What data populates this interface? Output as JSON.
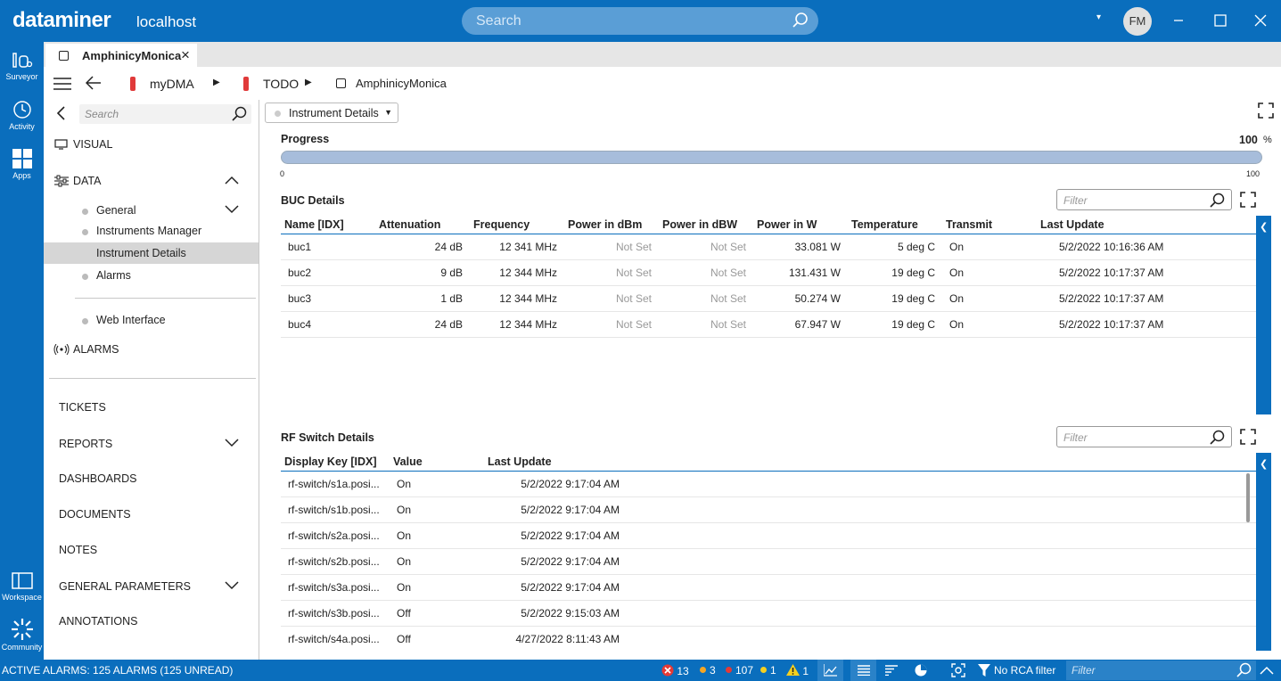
{
  "app": {
    "brand": "dataminer",
    "host": "localhost",
    "search_placeholder": "Search",
    "user_initials": "FM"
  },
  "rail": [
    {
      "label": "Surveyor",
      "icon": "surveyor-icon"
    },
    {
      "label": "Activity",
      "icon": "activity-icon"
    },
    {
      "label": "Apps",
      "icon": "apps-icon"
    },
    {
      "label": "Workspace",
      "icon": "workspace-icon"
    },
    {
      "label": "Community",
      "icon": "community-icon"
    }
  ],
  "tab": {
    "label": "AmphinicyMonica"
  },
  "breadcrumb": [
    "myDMA",
    "TODO",
    "AmphinicyMonica"
  ],
  "sidebar": {
    "search_placeholder": "Search",
    "visual": "VISUAL",
    "data": "DATA",
    "data_items": [
      "General",
      "Instruments Manager",
      "Instrument Details",
      "Alarms"
    ],
    "web_interface": "Web Interface",
    "alarms": "ALARMS",
    "sections": [
      "TICKETS",
      "REPORTS",
      "DASHBOARDS",
      "DOCUMENTS",
      "NOTES",
      "GENERAL PARAMETERS",
      "ANNOTATIONS"
    ]
  },
  "main": {
    "page_select": "Instrument Details",
    "progress": {
      "label": "Progress",
      "value_text": "100",
      "unit": "%",
      "min": "0",
      "max": "100",
      "fraction": 1.0
    },
    "buc": {
      "title": "BUC Details",
      "filter_placeholder": "Filter",
      "columns": [
        "Name [IDX]",
        "Attenuation",
        "Frequency",
        "Power in dBm",
        "Power in dBW",
        "Power in W",
        "Temperature",
        "Transmit",
        "Last Update"
      ],
      "rows": [
        [
          "buc1",
          "24 dB",
          "12 341 MHz",
          "Not Set",
          "Not Set",
          "33.081 W",
          "5 deg C",
          "On",
          "5/2/2022 10:16:36 AM"
        ],
        [
          "buc2",
          "9 dB",
          "12 344 MHz",
          "Not Set",
          "Not Set",
          "131.431 W",
          "19 deg C",
          "On",
          "5/2/2022 10:17:37 AM"
        ],
        [
          "buc3",
          "1 dB",
          "12 344 MHz",
          "Not Set",
          "Not Set",
          "50.274 W",
          "19 deg C",
          "On",
          "5/2/2022 10:17:37 AM"
        ],
        [
          "buc4",
          "24 dB",
          "12 344 MHz",
          "Not Set",
          "Not Set",
          "67.947 W",
          "19 deg C",
          "On",
          "5/2/2022 10:17:37 AM"
        ]
      ]
    },
    "rf": {
      "title": "RF Switch Details",
      "filter_placeholder": "Filter",
      "columns": [
        "Display Key [IDX]",
        "Value",
        "Last Update"
      ],
      "rows": [
        [
          "rf-switch/s1a.posi...",
          "On",
          "5/2/2022 9:17:04 AM"
        ],
        [
          "rf-switch/s1b.posi...",
          "On",
          "5/2/2022 9:17:04 AM"
        ],
        [
          "rf-switch/s2a.posi...",
          "On",
          "5/2/2022 9:17:04 AM"
        ],
        [
          "rf-switch/s2b.posi...",
          "On",
          "5/2/2022 9:17:04 AM"
        ],
        [
          "rf-switch/s3a.posi...",
          "On",
          "5/2/2022 9:17:04 AM"
        ],
        [
          "rf-switch/s3b.posi...",
          "Off",
          "5/2/2022 9:15:03 AM"
        ],
        [
          "rf-switch/s4a.posi...",
          "Off",
          "4/27/2022 8:11:43 AM"
        ]
      ]
    }
  },
  "status": {
    "active_alarms": "ACTIVE ALARMS: 125 ALARMS (125 UNREAD)",
    "critical": "13",
    "major": "3",
    "minor": "107",
    "warning": "1",
    "notice": "1",
    "rca": "No RCA filter",
    "filter_placeholder": "Filter",
    "colors": {
      "critical": "#e53935",
      "major": "#f5a623",
      "minor": "#e53935",
      "warning": "#f5d020"
    }
  }
}
